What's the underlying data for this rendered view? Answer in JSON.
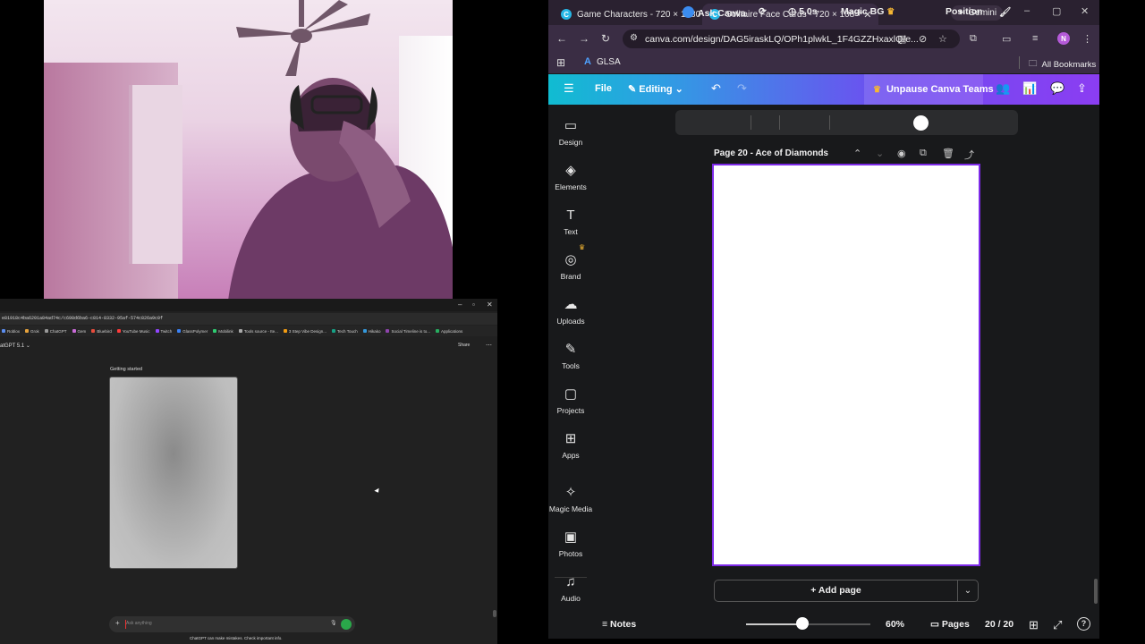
{
  "chat_window": {
    "url": "e81918c4ba6201a84ad74c/c698d6ba6-c814-8332-95af-574c826a9c0f",
    "bookmarks": [
      "Roblox",
      "Grok",
      "ChatGPT",
      "Gem",
      "Bluebird",
      "YouTube Music",
      "Twitch",
      "GlassPolymer",
      "Mobilink",
      "Tools source - Ite...",
      "3 Step Vibe Design...",
      "Tech Touch",
      "Hikako",
      "Social Timeline is to...",
      "Applications"
    ],
    "model_label": "atGPT 5.1 ⌄",
    "share_label": "Share",
    "more_label": "⋯",
    "section_title": "Getting started",
    "input_placeholder": "Ask anything",
    "input_plus": "+",
    "disclaimer": "ChatGPT can make mistakes. Check important info."
  },
  "browser": {
    "tabs": [
      {
        "title": "Game Characters - 720 × 1080",
        "active": false,
        "close": "✕"
      },
      {
        "title": "Solitaire Face Cards - 720 × 108",
        "active": true,
        "close": "✕"
      }
    ],
    "new_tab": "+",
    "gemini_label": "Gemini",
    "window_controls": [
      "–",
      "▢",
      "✕"
    ],
    "url": "canva.com/design/DAG5iraskLQ/OPh1plwkL_1F4GZZHxaxlQ/e...",
    "profile_initial": "N",
    "bookmark_glsa": "GLSA",
    "all_bookmarks": "All Bookmarks"
  },
  "canva": {
    "toolbar": {
      "menu_icon": "☰",
      "file_label": "File",
      "editing_label": "Editing",
      "undo": "↶",
      "redo": "↷",
      "unpause_label": "Unpause Canva Teams"
    },
    "sidebar": [
      {
        "icon": "▭",
        "label": "Design"
      },
      {
        "icon": "◈",
        "label": "Elements"
      },
      {
        "icon": "T",
        "label": "Text"
      },
      {
        "icon": "◎",
        "label": "Brand"
      },
      {
        "icon": "☁",
        "label": "Uploads"
      },
      {
        "icon": "✎",
        "label": "Tools"
      },
      {
        "icon": "▢",
        "label": "Projects"
      },
      {
        "icon": "⊞",
        "label": "Apps"
      },
      {
        "icon": "✧",
        "label": "Magic Media"
      },
      {
        "icon": "▣",
        "label": "Photos"
      },
      {
        "icon": "♫",
        "label": "Audio"
      }
    ],
    "context_bar": {
      "ask_canva": "Ask Canva",
      "duration": "5.0s",
      "magic_bg": "Magic BG",
      "position": "Position"
    },
    "page": {
      "title": "Page 20 - Ace of Diamonds"
    },
    "add_page_label": "+ Add page",
    "footer": {
      "notes_label": "Notes",
      "zoom_percent": 60,
      "zoom_label": "60%",
      "pages_label": "Pages",
      "page_count": "20 / 20"
    },
    "colors": {
      "accent": "#7d2ae8",
      "crown": "#f6b733",
      "gradient_start": "#10bcd1",
      "gradient_end": "#8b3df2"
    }
  }
}
